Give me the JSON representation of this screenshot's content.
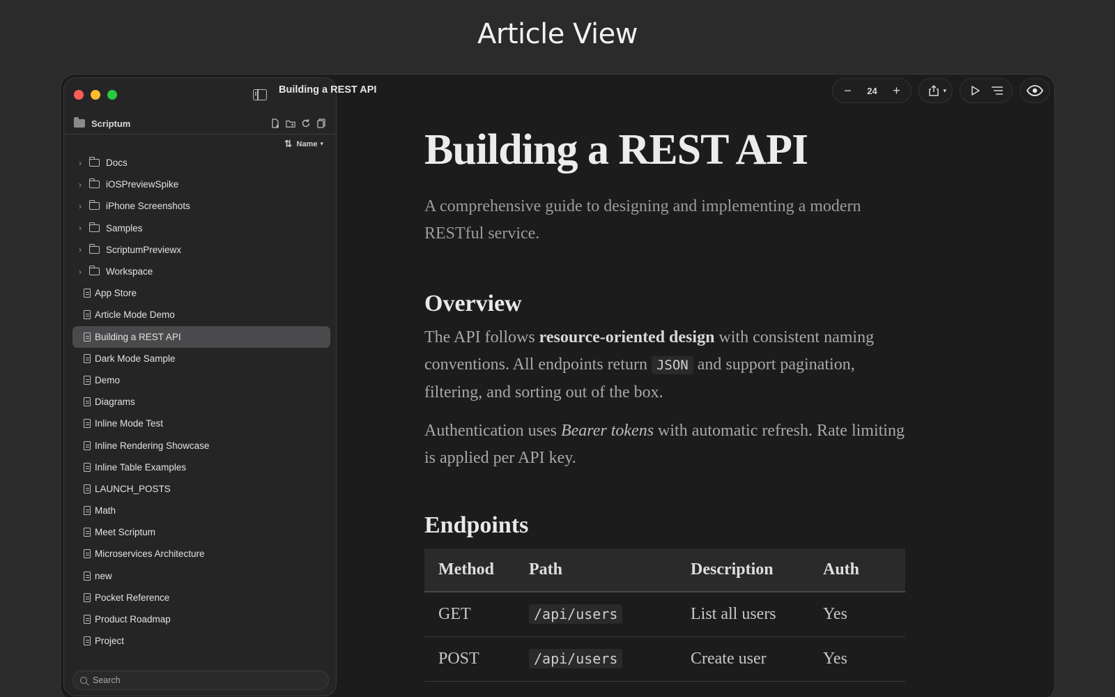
{
  "page": {
    "heading": "Article View"
  },
  "sidebar": {
    "workspace": "Scriptum",
    "sort_label": "Name",
    "items": [
      {
        "label": "Docs",
        "type": "folder"
      },
      {
        "label": "iOSPreviewSpike",
        "type": "folder"
      },
      {
        "label": "iPhone Screenshots",
        "type": "folder"
      },
      {
        "label": "Samples",
        "type": "folder"
      },
      {
        "label": "ScriptumPreviewx",
        "type": "folder"
      },
      {
        "label": "Workspace",
        "type": "folder"
      },
      {
        "label": "App Store",
        "type": "file"
      },
      {
        "label": "Article Mode Demo",
        "type": "file"
      },
      {
        "label": "Building a REST API",
        "type": "file",
        "selected": true
      },
      {
        "label": "Dark Mode Sample",
        "type": "file"
      },
      {
        "label": "Demo",
        "type": "file"
      },
      {
        "label": "Diagrams",
        "type": "file"
      },
      {
        "label": "Inline Mode Test",
        "type": "file"
      },
      {
        "label": "Inline Rendering Showcase",
        "type": "file"
      },
      {
        "label": "Inline Table Examples",
        "type": "file"
      },
      {
        "label": "LAUNCH_POSTS",
        "type": "file"
      },
      {
        "label": "Math",
        "type": "file"
      },
      {
        "label": "Meet Scriptum",
        "type": "file"
      },
      {
        "label": "Microservices Architecture",
        "type": "file"
      },
      {
        "label": "new",
        "type": "file"
      },
      {
        "label": "Pocket Reference",
        "type": "file"
      },
      {
        "label": "Product Roadmap",
        "type": "file"
      },
      {
        "label": "Project",
        "type": "file"
      }
    ],
    "search_placeholder": "Search"
  },
  "toolbar": {
    "doc_title": "Building a REST API",
    "zoom_value": "24"
  },
  "article": {
    "title": "Building a REST API",
    "subtitle": "A comprehensive guide to designing and implementing a modern RESTful service.",
    "overview_heading": "Overview",
    "p1_a": "The API follows ",
    "p1_bold": "resource-oriented design",
    "p1_b": " with consistent naming conventions. All endpoints return ",
    "p1_code": "JSON",
    "p1_c": " and support pagination, filtering, and sorting out of the box.",
    "p2_a": "Authentication uses ",
    "p2_italic": "Bearer tokens",
    "p2_b": " with automatic refresh. Rate limiting is applied per API key.",
    "endpoints_heading": "Endpoints",
    "table": {
      "headers": [
        "Method",
        "Path",
        "Description",
        "Auth"
      ],
      "rows": [
        [
          "GET",
          "/api/users",
          "List all users",
          "Yes"
        ],
        [
          "POST",
          "/api/users",
          "Create user",
          "Yes"
        ]
      ]
    }
  }
}
